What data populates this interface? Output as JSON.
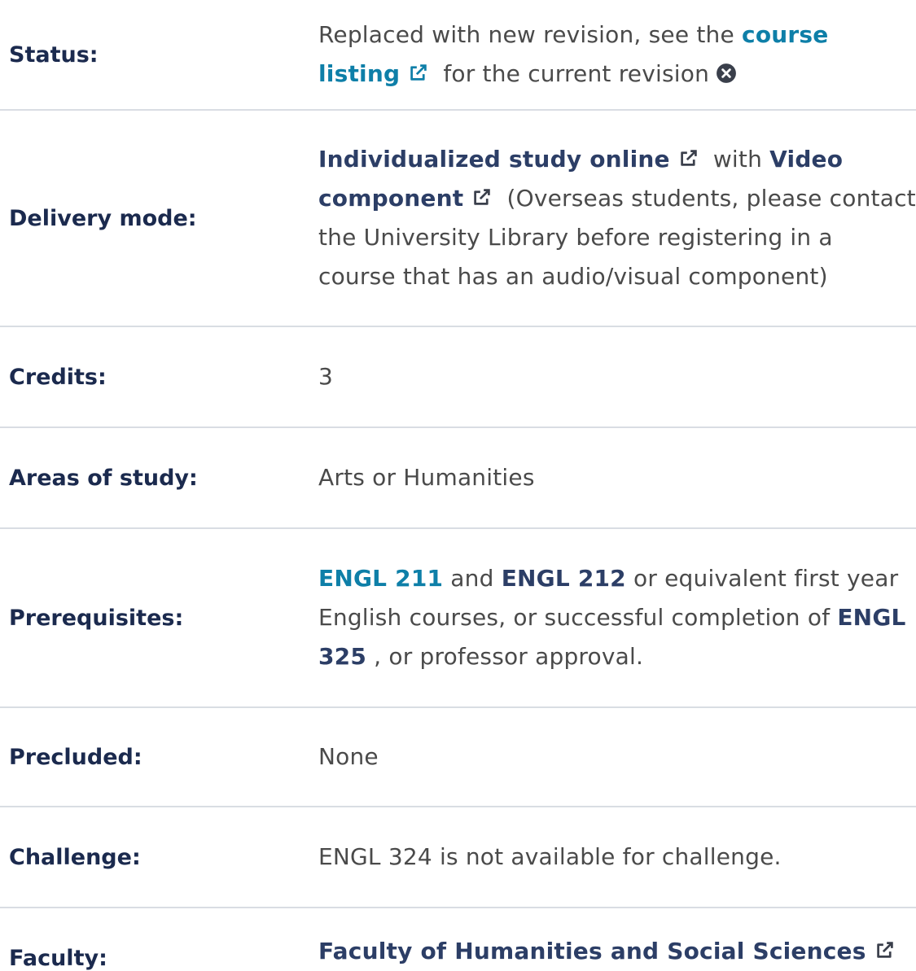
{
  "rows": {
    "status": {
      "label": "Status:",
      "text_before": "Replaced with new revision, see the",
      "link": "course listing",
      "text_after": "for the current revision"
    },
    "delivery": {
      "label": "Delivery mode:",
      "link1": "Individualized study online",
      "with": "with",
      "link2": "Video component",
      "note": "(Overseas students, please contact the University Library before registering in a course that has an audio/visual component)"
    },
    "credits": {
      "label": "Credits:",
      "value": "3"
    },
    "areas": {
      "label": "Areas of study:",
      "value": "Arts or Humanities"
    },
    "prereq": {
      "label": "Prerequisites:",
      "link1": "ENGL 211",
      "and": "and",
      "link2": "ENGL 212",
      "text_mid": "or equivalent first year English courses, or successful completion of",
      "link3": "ENGL 325",
      "text_end": ", or professor approval."
    },
    "precluded": {
      "label": "Precluded:",
      "value": "None"
    },
    "challenge": {
      "label": "Challenge:",
      "value": "ENGL 324 is not available for challenge."
    },
    "faculty": {
      "label": "Faculty:",
      "link": "Faculty of Humanities and Social Sciences"
    }
  },
  "icons": {
    "external": "external-link-icon",
    "close": "close-circle-icon"
  },
  "colors": {
    "label": "#1b2a4e",
    "link_teal": "#0e7fa8",
    "link_navy": "#2c3e66",
    "text": "#4a4a4a",
    "divider": "#d9dde3"
  }
}
